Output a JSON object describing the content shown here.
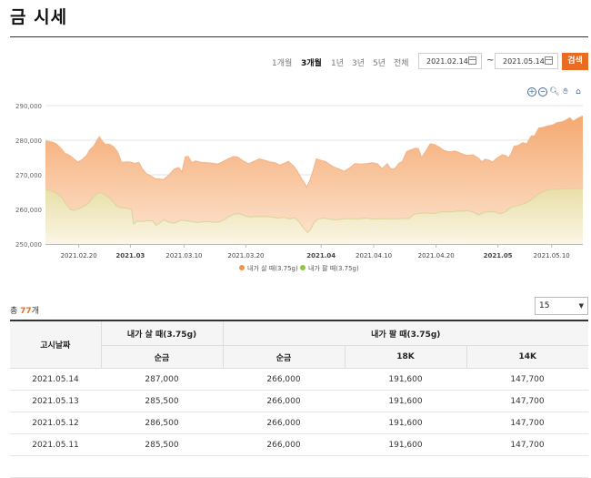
{
  "page": {
    "title": "금 시세"
  },
  "periods": [
    {
      "label": "1개월",
      "active": false
    },
    {
      "label": "3개월",
      "active": true
    },
    {
      "label": "1년",
      "active": false
    },
    {
      "label": "3년",
      "active": false
    },
    {
      "label": "5년",
      "active": false
    },
    {
      "label": "전체",
      "active": false
    }
  ],
  "date_range": {
    "start": "2021.02.14",
    "separator": "~",
    "end": "2021.05.14"
  },
  "search_label": "검색",
  "chart_tools": [
    "zoom-in-icon",
    "zoom-out-icon",
    "magnifier-icon",
    "hand-icon",
    "home-icon"
  ],
  "colors": {
    "accent": "#e96b24",
    "buy_series": "#f2934d",
    "sell_series": "#8dc63f"
  },
  "chart_data": {
    "type": "area",
    "ylim": [
      250000,
      290000
    ],
    "y_ticks": [
      "250,000",
      "260,000",
      "270,000",
      "280,000",
      "290,000"
    ],
    "x_ticks": [
      {
        "label": "2021.02.20",
        "bold": false,
        "t": 0.062
      },
      {
        "label": "2021.03",
        "bold": true,
        "t": 0.158
      },
      {
        "label": "2021.03.10",
        "bold": false,
        "t": 0.258
      },
      {
        "label": "2021.03.20",
        "bold": false,
        "t": 0.373
      },
      {
        "label": "2021.04",
        "bold": true,
        "t": 0.513
      },
      {
        "label": "2021.04.10",
        "bold": false,
        "t": 0.611
      },
      {
        "label": "2021.04.20",
        "bold": false,
        "t": 0.727
      },
      {
        "label": "2021.05",
        "bold": true,
        "t": 0.842
      },
      {
        "label": "2021.05.10",
        "bold": false,
        "t": 0.942
      }
    ],
    "series": [
      {
        "name": "내가 살 때(3.75g)",
        "color": "#f2934d",
        "points": [
          [
            0.0,
            279800
          ],
          [
            0.012,
            279500
          ],
          [
            0.02,
            279000
          ],
          [
            0.028,
            277800
          ],
          [
            0.036,
            276300
          ],
          [
            0.045,
            275600
          ],
          [
            0.053,
            274600
          ],
          [
            0.06,
            273700
          ],
          [
            0.068,
            274400
          ],
          [
            0.076,
            275500
          ],
          [
            0.083,
            277400
          ],
          [
            0.09,
            278300
          ],
          [
            0.096,
            280000
          ],
          [
            0.1,
            281000
          ],
          [
            0.106,
            279700
          ],
          [
            0.112,
            278700
          ],
          [
            0.118,
            278900
          ],
          [
            0.126,
            278200
          ],
          [
            0.134,
            276700
          ],
          [
            0.142,
            273500
          ],
          [
            0.15,
            273700
          ],
          [
            0.158,
            273700
          ],
          [
            0.166,
            273300
          ],
          [
            0.174,
            273600
          ],
          [
            0.18,
            271800
          ],
          [
            0.188,
            270300
          ],
          [
            0.196,
            269700
          ],
          [
            0.204,
            268900
          ],
          [
            0.212,
            268800
          ],
          [
            0.22,
            268600
          ],
          [
            0.23,
            270000
          ],
          [
            0.24,
            271700
          ],
          [
            0.248,
            272100
          ],
          [
            0.254,
            270800
          ],
          [
            0.26,
            275200
          ],
          [
            0.266,
            275300
          ],
          [
            0.272,
            273500
          ],
          [
            0.28,
            274000
          ],
          [
            0.29,
            273600
          ],
          [
            0.3,
            273500
          ],
          [
            0.31,
            273400
          ],
          [
            0.32,
            273100
          ],
          [
            0.33,
            273800
          ],
          [
            0.34,
            274600
          ],
          [
            0.35,
            275300
          ],
          [
            0.358,
            275100
          ],
          [
            0.368,
            274000
          ],
          [
            0.378,
            273200
          ],
          [
            0.388,
            273900
          ],
          [
            0.398,
            274600
          ],
          [
            0.408,
            274200
          ],
          [
            0.418,
            273700
          ],
          [
            0.428,
            273500
          ],
          [
            0.436,
            272800
          ],
          [
            0.444,
            273300
          ],
          [
            0.452,
            273900
          ],
          [
            0.462,
            272500
          ],
          [
            0.468,
            271200
          ],
          [
            0.476,
            269000
          ],
          [
            0.482,
            267700
          ],
          [
            0.486,
            266400
          ],
          [
            0.492,
            268400
          ],
          [
            0.498,
            271100
          ],
          [
            0.504,
            274600
          ],
          [
            0.512,
            274200
          ],
          [
            0.52,
            273900
          ],
          [
            0.528,
            273100
          ],
          [
            0.536,
            272300
          ],
          [
            0.546,
            271700
          ],
          [
            0.556,
            271000
          ],
          [
            0.566,
            272000
          ],
          [
            0.576,
            273200
          ],
          [
            0.588,
            273100
          ],
          [
            0.598,
            273200
          ],
          [
            0.608,
            273500
          ],
          [
            0.618,
            273200
          ],
          [
            0.626,
            271800
          ],
          [
            0.636,
            273200
          ],
          [
            0.642,
            271800
          ],
          [
            0.65,
            271800
          ],
          [
            0.658,
            273400
          ],
          [
            0.664,
            273800
          ],
          [
            0.672,
            276700
          ],
          [
            0.68,
            277200
          ],
          [
            0.688,
            277700
          ],
          [
            0.694,
            277600
          ],
          [
            0.7,
            275000
          ],
          [
            0.708,
            276900
          ],
          [
            0.716,
            279000
          ],
          [
            0.724,
            278700
          ],
          [
            0.732,
            278100
          ],
          [
            0.742,
            277000
          ],
          [
            0.752,
            276600
          ],
          [
            0.762,
            276900
          ],
          [
            0.772,
            276300
          ],
          [
            0.784,
            275600
          ],
          [
            0.796,
            275800
          ],
          [
            0.806,
            274800
          ],
          [
            0.812,
            273800
          ],
          [
            0.818,
            274500
          ],
          [
            0.826,
            274200
          ],
          [
            0.832,
            273700
          ],
          [
            0.84,
            274800
          ],
          [
            0.85,
            275800
          ],
          [
            0.856,
            275600
          ],
          [
            0.862,
            274900
          ],
          [
            0.868,
            276600
          ],
          [
            0.872,
            278300
          ],
          [
            0.88,
            278500
          ],
          [
            0.888,
            279300
          ],
          [
            0.896,
            279000
          ],
          [
            0.904,
            281300
          ],
          [
            0.91,
            281200
          ],
          [
            0.918,
            283500
          ],
          [
            0.926,
            283700
          ],
          [
            0.934,
            284100
          ],
          [
            0.944,
            284400
          ],
          [
            0.952,
            285100
          ],
          [
            0.96,
            285300
          ],
          [
            0.966,
            285600
          ],
          [
            0.97,
            286000
          ],
          [
            0.976,
            286500
          ],
          [
            0.982,
            285500
          ],
          [
            0.99,
            286300
          ],
          [
            0.995,
            286700
          ],
          [
            1.0,
            287000
          ]
        ]
      },
      {
        "name": "내가 팔 때(3.75g)",
        "color": "#8dc63f",
        "points": [
          [
            0.0,
            265800
          ],
          [
            0.01,
            265400
          ],
          [
            0.02,
            264700
          ],
          [
            0.03,
            263500
          ],
          [
            0.038,
            261600
          ],
          [
            0.046,
            260000
          ],
          [
            0.054,
            259700
          ],
          [
            0.062,
            260200
          ],
          [
            0.07,
            260800
          ],
          [
            0.078,
            261500
          ],
          [
            0.086,
            263000
          ],
          [
            0.094,
            264400
          ],
          [
            0.102,
            264900
          ],
          [
            0.11,
            264300
          ],
          [
            0.118,
            263500
          ],
          [
            0.124,
            262600
          ],
          [
            0.132,
            261000
          ],
          [
            0.14,
            260500
          ],
          [
            0.15,
            260400
          ],
          [
            0.16,
            260000
          ],
          [
            0.164,
            255800
          ],
          [
            0.17,
            256600
          ],
          [
            0.18,
            256500
          ],
          [
            0.19,
            256800
          ],
          [
            0.2,
            256600
          ],
          [
            0.206,
            255400
          ],
          [
            0.214,
            256200
          ],
          [
            0.22,
            257100
          ],
          [
            0.23,
            256300
          ],
          [
            0.24,
            256000
          ],
          [
            0.252,
            256900
          ],
          [
            0.262,
            256700
          ],
          [
            0.272,
            256500
          ],
          [
            0.282,
            256200
          ],
          [
            0.292,
            256400
          ],
          [
            0.302,
            256500
          ],
          [
            0.312,
            256300
          ],
          [
            0.322,
            256300
          ],
          [
            0.332,
            257000
          ],
          [
            0.342,
            258000
          ],
          [
            0.352,
            258700
          ],
          [
            0.362,
            258700
          ],
          [
            0.372,
            258100
          ],
          [
            0.382,
            257800
          ],
          [
            0.392,
            258000
          ],
          [
            0.402,
            257900
          ],
          [
            0.412,
            258000
          ],
          [
            0.422,
            257800
          ],
          [
            0.432,
            257500
          ],
          [
            0.444,
            257700
          ],
          [
            0.454,
            257300
          ],
          [
            0.464,
            257600
          ],
          [
            0.472,
            256400
          ],
          [
            0.48,
            254700
          ],
          [
            0.488,
            253300
          ],
          [
            0.494,
            254400
          ],
          [
            0.5,
            256200
          ],
          [
            0.508,
            257300
          ],
          [
            0.52,
            257500
          ],
          [
            0.532,
            257100
          ],
          [
            0.544,
            257000
          ],
          [
            0.556,
            257300
          ],
          [
            0.57,
            257300
          ],
          [
            0.584,
            257300
          ],
          [
            0.598,
            257500
          ],
          [
            0.612,
            257200
          ],
          [
            0.626,
            257300
          ],
          [
            0.64,
            257300
          ],
          [
            0.654,
            257300
          ],
          [
            0.666,
            257400
          ],
          [
            0.676,
            257400
          ],
          [
            0.686,
            258600
          ],
          [
            0.696,
            258900
          ],
          [
            0.706,
            259000
          ],
          [
            0.716,
            258900
          ],
          [
            0.726,
            258900
          ],
          [
            0.736,
            259300
          ],
          [
            0.746,
            259300
          ],
          [
            0.756,
            259300
          ],
          [
            0.766,
            259500
          ],
          [
            0.776,
            259500
          ],
          [
            0.786,
            259600
          ],
          [
            0.796,
            259300
          ],
          [
            0.806,
            258400
          ],
          [
            0.816,
            259100
          ],
          [
            0.826,
            259400
          ],
          [
            0.836,
            259300
          ],
          [
            0.846,
            258700
          ],
          [
            0.856,
            259300
          ],
          [
            0.866,
            260600
          ],
          [
            0.876,
            261000
          ],
          [
            0.886,
            261400
          ],
          [
            0.896,
            262000
          ],
          [
            0.906,
            263000
          ],
          [
            0.916,
            264300
          ],
          [
            0.926,
            265100
          ],
          [
            0.936,
            265700
          ],
          [
            0.946,
            265800
          ],
          [
            0.96,
            265900
          ],
          [
            0.98,
            266000
          ],
          [
            1.0,
            266000
          ]
        ]
      }
    ]
  },
  "table": {
    "count_prefix": "총 ",
    "count": "77",
    "count_suffix": "개",
    "page_size": "15",
    "headers": {
      "date": "고시날짜",
      "buy_group": "내가 살 때(3.75g)",
      "sell_group": "내가 팔 때(3.75g)",
      "buy_pure": "순금",
      "sell_pure": "순금",
      "sell_18k": "18K",
      "sell_14k": "14K"
    },
    "rows": [
      [
        "2021.05.14",
        "287,000",
        "266,000",
        "191,600",
        "147,700"
      ],
      [
        "2021.05.13",
        "285,500",
        "266,000",
        "191,600",
        "147,700"
      ],
      [
        "2021.05.12",
        "286,500",
        "266,000",
        "191,600",
        "147,700"
      ],
      [
        "2021.05.11",
        "285,500",
        "266,000",
        "191,600",
        "147,700"
      ],
      [
        "",
        "",
        "",
        "",
        ""
      ]
    ]
  }
}
